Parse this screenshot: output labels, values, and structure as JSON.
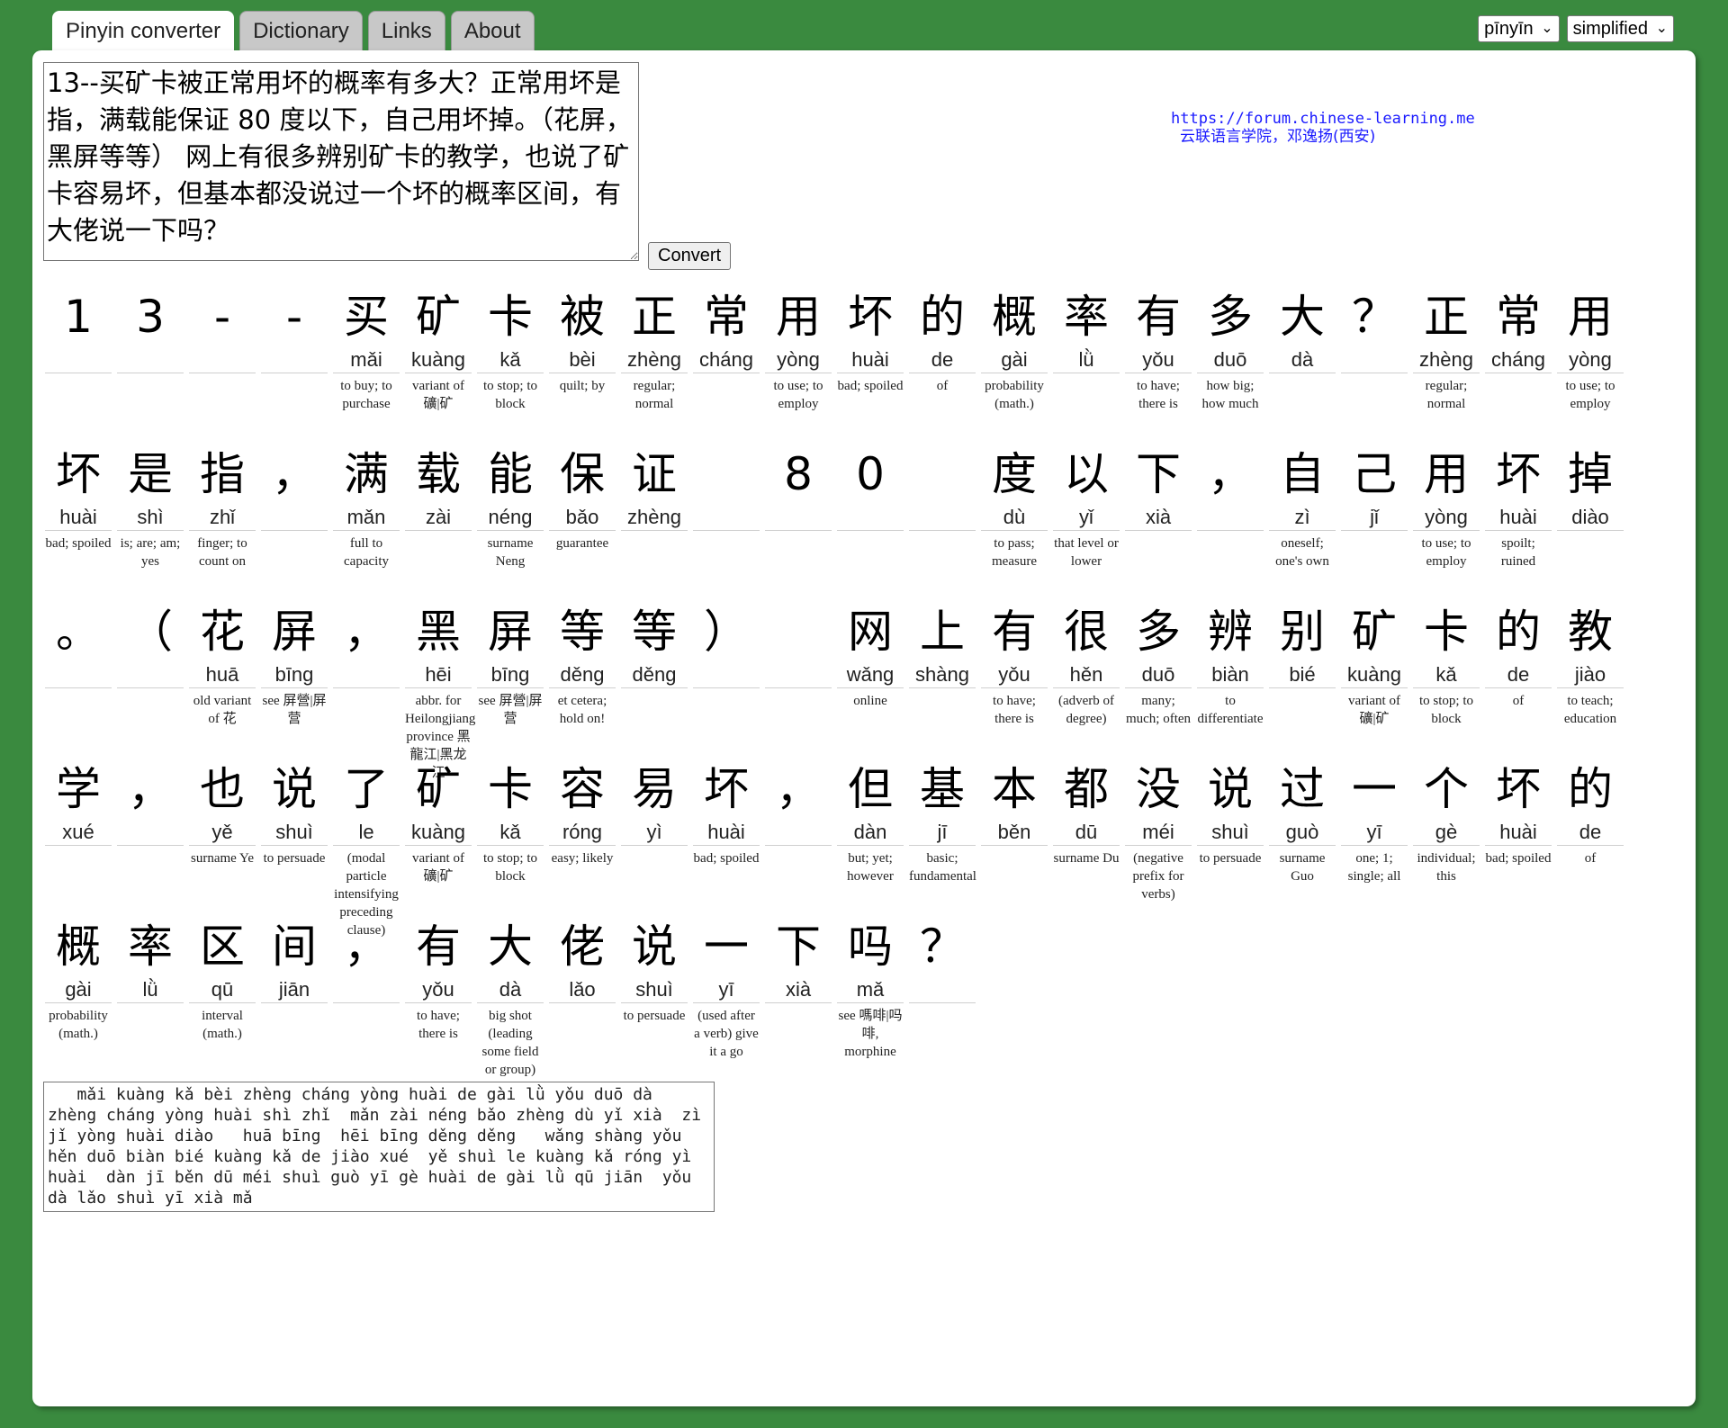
{
  "tabs": [
    "Pinyin converter",
    "Dictionary",
    "Links",
    "About"
  ],
  "selects": {
    "mode": "pīnyīn",
    "script": "simplified"
  },
  "input_text": "13--买矿卡被正常用坏的概率有多大？正常用坏是指，满载能保证 80 度以下，自己用坏掉。（花屏，黑屏等等） 网上有很多辨别矿卡的教学，也说了矿卡容易坏，但基本都没说过一个坏的概率区间，有大佬说一下吗？",
  "convert_label": "Convert",
  "credit": {
    "url": "https://forum.chinese-learning.me",
    "name": "云联语言学院，邓逸扬(西安)"
  },
  "tokens": [
    {
      "hz": "1",
      "py": "",
      "gl": ""
    },
    {
      "hz": "3",
      "py": "",
      "gl": ""
    },
    {
      "hz": "-",
      "py": "",
      "gl": ""
    },
    {
      "hz": "-",
      "py": "",
      "gl": ""
    },
    {
      "hz": "买",
      "py": "mǎi",
      "gl": "to buy; to purchase"
    },
    {
      "hz": "矿",
      "py": "kuàng",
      "gl": "variant of 礦|矿"
    },
    {
      "hz": "卡",
      "py": "kǎ",
      "gl": "to stop; to block"
    },
    {
      "hz": "被",
      "py": "bèi",
      "gl": "quilt; by"
    },
    {
      "hz": "正",
      "py": "zhèng",
      "gl": "regular; normal"
    },
    {
      "hz": "常",
      "py": "cháng",
      "gl": ""
    },
    {
      "hz": "用",
      "py": "yòng",
      "gl": "to use; to employ"
    },
    {
      "hz": "坏",
      "py": "huài",
      "gl": "bad; spoiled"
    },
    {
      "hz": "的",
      "py": "de",
      "gl": "of"
    },
    {
      "hz": "概",
      "py": "gài",
      "gl": "probability (math.)"
    },
    {
      "hz": "率",
      "py": "lǜ",
      "gl": ""
    },
    {
      "hz": "有",
      "py": "yǒu",
      "gl": "to have; there is"
    },
    {
      "hz": "多",
      "py": "duō",
      "gl": "how big; how much"
    },
    {
      "hz": "大",
      "py": "dà",
      "gl": ""
    },
    {
      "hz": "？",
      "py": "",
      "gl": ""
    },
    {
      "hz": "正",
      "py": "zhèng",
      "gl": "regular; normal"
    },
    {
      "hz": "常",
      "py": "cháng",
      "gl": ""
    },
    {
      "hz": "用",
      "py": "yòng",
      "gl": "to use; to employ"
    },
    {
      "hz": "坏",
      "py": "huài",
      "gl": "bad; spoiled"
    },
    {
      "hz": "是",
      "py": "shì",
      "gl": "is; are; am; yes"
    },
    {
      "hz": "指",
      "py": "zhǐ",
      "gl": "finger; to count on"
    },
    {
      "hz": "，",
      "py": "",
      "gl": ""
    },
    {
      "hz": "满",
      "py": "mǎn",
      "gl": "full to capacity"
    },
    {
      "hz": "载",
      "py": "zài",
      "gl": ""
    },
    {
      "hz": "能",
      "py": "néng",
      "gl": "surname Neng"
    },
    {
      "hz": "保",
      "py": "bǎo",
      "gl": "guarantee"
    },
    {
      "hz": "证",
      "py": "zhèng",
      "gl": ""
    },
    {
      "hz": "",
      "py": "",
      "gl": ""
    },
    {
      "hz": "8",
      "py": "",
      "gl": ""
    },
    {
      "hz": "0",
      "py": "",
      "gl": ""
    },
    {
      "hz": "",
      "py": "",
      "gl": ""
    },
    {
      "hz": "度",
      "py": "dù",
      "gl": "to pass; measure"
    },
    {
      "hz": "以",
      "py": "yǐ",
      "gl": "that level or lower"
    },
    {
      "hz": "下",
      "py": "xià",
      "gl": ""
    },
    {
      "hz": "，",
      "py": "",
      "gl": ""
    },
    {
      "hz": "自",
      "py": "zì",
      "gl": "oneself; one's own"
    },
    {
      "hz": "己",
      "py": "jǐ",
      "gl": ""
    },
    {
      "hz": "用",
      "py": "yòng",
      "gl": "to use; to employ"
    },
    {
      "hz": "坏",
      "py": "huài",
      "gl": "spoilt; ruined"
    },
    {
      "hz": "掉",
      "py": "diào",
      "gl": ""
    },
    {
      "hz": "。",
      "py": "",
      "gl": ""
    },
    {
      "hz": "（",
      "py": "",
      "gl": ""
    },
    {
      "hz": "花",
      "py": "huā",
      "gl": "old variant of 花"
    },
    {
      "hz": "屏",
      "py": "bīng",
      "gl": "see 屏營|屏营"
    },
    {
      "hz": "，",
      "py": "",
      "gl": ""
    },
    {
      "hz": "黑",
      "py": "hēi",
      "gl": "abbr. for Heilongjiang province 黑龍江|黑龙江"
    },
    {
      "hz": "屏",
      "py": "bīng",
      "gl": "see 屏營|屏营"
    },
    {
      "hz": "等",
      "py": "děng",
      "gl": "et cetera; hold on!"
    },
    {
      "hz": "等",
      "py": "děng",
      "gl": ""
    },
    {
      "hz": "）",
      "py": "",
      "gl": ""
    },
    {
      "hz": "",
      "py": "",
      "gl": ""
    },
    {
      "hz": "网",
      "py": "wǎng",
      "gl": "online"
    },
    {
      "hz": "上",
      "py": "shàng",
      "gl": ""
    },
    {
      "hz": "有",
      "py": "yǒu",
      "gl": "to have; there is"
    },
    {
      "hz": "很",
      "py": "hěn",
      "gl": "(adverb of degree)"
    },
    {
      "hz": "多",
      "py": "duō",
      "gl": "many; much; often"
    },
    {
      "hz": "辨",
      "py": "biàn",
      "gl": "to differentiate"
    },
    {
      "hz": "别",
      "py": "bié",
      "gl": ""
    },
    {
      "hz": "矿",
      "py": "kuàng",
      "gl": "variant of 礦|矿"
    },
    {
      "hz": "卡",
      "py": "kǎ",
      "gl": "to stop; to block"
    },
    {
      "hz": "的",
      "py": "de",
      "gl": "of"
    },
    {
      "hz": "教",
      "py": "jiào",
      "gl": "to teach; education"
    },
    {
      "hz": "学",
      "py": "xué",
      "gl": ""
    },
    {
      "hz": "，",
      "py": "",
      "gl": ""
    },
    {
      "hz": "也",
      "py": "yě",
      "gl": "surname Ye"
    },
    {
      "hz": "说",
      "py": "shuì",
      "gl": "to persuade"
    },
    {
      "hz": "了",
      "py": "le",
      "gl": "(modal particle intensifying preceding clause)"
    },
    {
      "hz": "矿",
      "py": "kuàng",
      "gl": "variant of 礦|矿"
    },
    {
      "hz": "卡",
      "py": "kǎ",
      "gl": "to stop; to block"
    },
    {
      "hz": "容",
      "py": "róng",
      "gl": "easy; likely"
    },
    {
      "hz": "易",
      "py": "yì",
      "gl": ""
    },
    {
      "hz": "坏",
      "py": "huài",
      "gl": "bad; spoiled"
    },
    {
      "hz": "，",
      "py": "",
      "gl": ""
    },
    {
      "hz": "但",
      "py": "dàn",
      "gl": "but; yet; however"
    },
    {
      "hz": "基",
      "py": "jī",
      "gl": "basic; fundamental"
    },
    {
      "hz": "本",
      "py": "běn",
      "gl": ""
    },
    {
      "hz": "都",
      "py": "dū",
      "gl": "surname Du"
    },
    {
      "hz": "没",
      "py": "méi",
      "gl": "(negative prefix for verbs)"
    },
    {
      "hz": "说",
      "py": "shuì",
      "gl": "to persuade"
    },
    {
      "hz": "过",
      "py": "guò",
      "gl": "surname Guo"
    },
    {
      "hz": "一",
      "py": "yī",
      "gl": "one; 1; single; all"
    },
    {
      "hz": "个",
      "py": "gè",
      "gl": "individual; this"
    },
    {
      "hz": "坏",
      "py": "huài",
      "gl": "bad; spoiled"
    },
    {
      "hz": "的",
      "py": "de",
      "gl": "of"
    },
    {
      "hz": "概",
      "py": "gài",
      "gl": "probability (math.)"
    },
    {
      "hz": "率",
      "py": "lǜ",
      "gl": ""
    },
    {
      "hz": "区",
      "py": "qū",
      "gl": "interval (math.)"
    },
    {
      "hz": "间",
      "py": "jiān",
      "gl": ""
    },
    {
      "hz": "，",
      "py": "",
      "gl": ""
    },
    {
      "hz": "有",
      "py": "yǒu",
      "gl": "to have; there is"
    },
    {
      "hz": "大",
      "py": "dà",
      "gl": "big shot (leading some field or group)"
    },
    {
      "hz": "佬",
      "py": "lǎo",
      "gl": ""
    },
    {
      "hz": "说",
      "py": "shuì",
      "gl": "to persuade"
    },
    {
      "hz": "一",
      "py": "yī",
      "gl": "(used after a verb) give it a go"
    },
    {
      "hz": "下",
      "py": "xià",
      "gl": ""
    },
    {
      "hz": "吗",
      "py": "mǎ",
      "gl": "see 嗎啡|吗啡, morphine"
    },
    {
      "hz": "？",
      "py": "",
      "gl": ""
    }
  ],
  "output_text": "   mǎi kuàng kǎ bèi zhèng cháng yòng huài de gài lǜ yǒu duō dà  zhèng cháng yòng huài shì zhǐ  mǎn zài néng bǎo zhèng dù yǐ xià  zì jǐ yòng huài diào   huā bīng  hēi bīng děng děng   wǎng shàng yǒu hěn duō biàn bié kuàng kǎ de jiào xué  yě shuì le kuàng kǎ róng yì huài  dàn jī běn dū méi shuì guò yī gè huài de gài lǜ qū jiān  yǒu dà lǎo shuì yī xià mǎ"
}
